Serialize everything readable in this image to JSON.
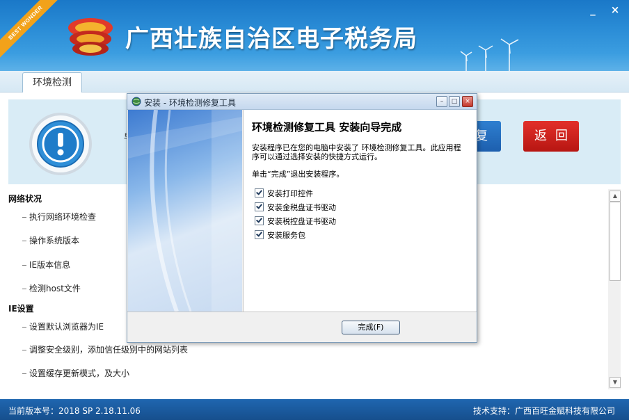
{
  "app": {
    "title": "广西壮族自治区电子税务局",
    "ribbon_text": "BEST WONDER",
    "minimize_label": "_",
    "close_label": "×"
  },
  "tabs": [
    {
      "label": "环境检测"
    }
  ],
  "main": {
    "stub_text": "早",
    "fix_button_label": "复",
    "back_button_label": "返回"
  },
  "checklist": {
    "network": {
      "title": "网络状况",
      "items": [
        "执行网络环境检查",
        "操作系统版本",
        "IE版本信息",
        "检测host文件"
      ]
    },
    "ie": {
      "title": "IE设置",
      "items": [
        "设置默认浏览器为IE",
        "调整安全级别，添加信任级别中的网站列表",
        "设置缓存更新模式，及大小"
      ]
    }
  },
  "status_bar": {
    "version_text": "当前版本号：2018 SP 2.18.11.06",
    "support_text": "技术支持：广西百旺金赋科技有限公司"
  },
  "dialog": {
    "title": "安装 - 环境检测修复工具",
    "heading": "环境检测修复工具  安装向导完成",
    "description": "安装程序已在您的电脑中安装了 环境检测修复工具。此应用程序可以通过选择安装的快捷方式运行。",
    "hint": "单击“完成”退出安装程序。",
    "options": [
      {
        "label": "安装打印控件",
        "checked": true
      },
      {
        "label": "安装金税盘证书驱动",
        "checked": true
      },
      {
        "label": "安装税控盘证书驱动",
        "checked": true
      },
      {
        "label": "安装服务包",
        "checked": true
      }
    ],
    "finish_label": "完成(F)",
    "controls": {
      "minimize": "–",
      "maximize": "□",
      "close": "×"
    }
  },
  "colors": {
    "header_blue": "#2a8cd6",
    "back_red": "#c8211c",
    "fix_blue": "#2367b8",
    "status_blue": "#1a5a9e"
  }
}
